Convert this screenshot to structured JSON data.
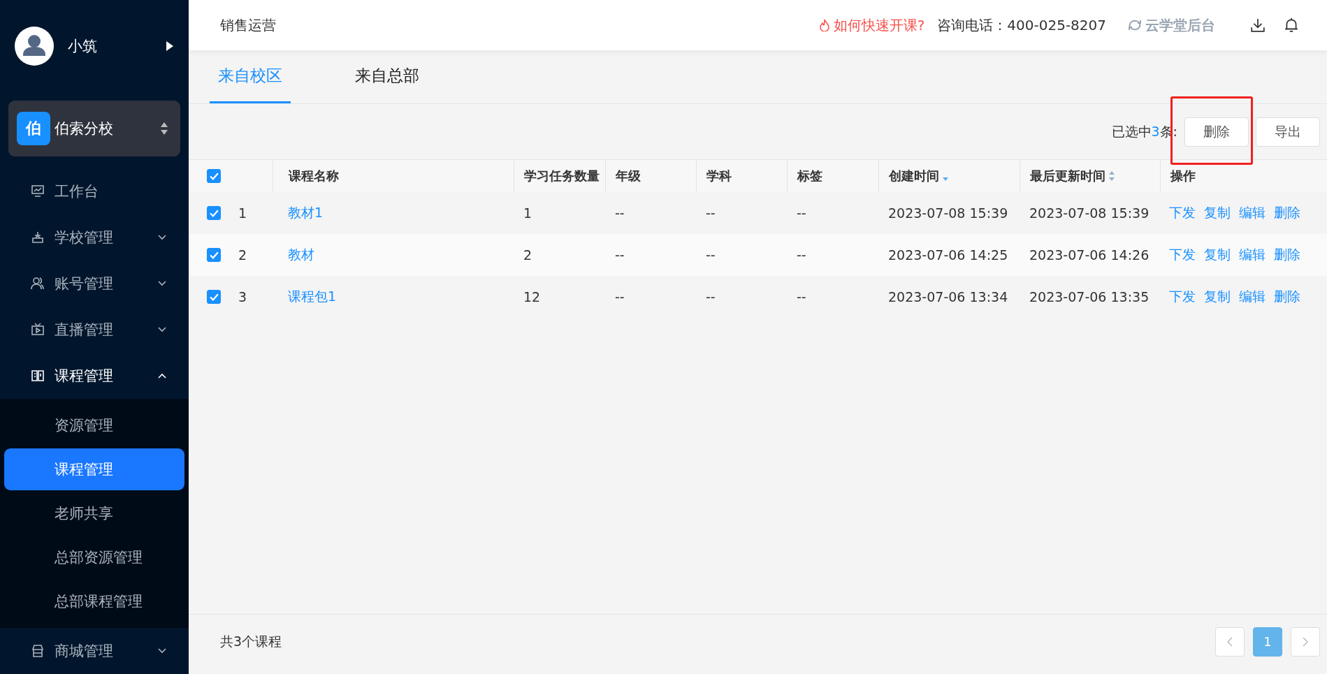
{
  "user": {
    "name": "小筑"
  },
  "campus": {
    "badge": "伯",
    "name": "伯索分校"
  },
  "sidebar": {
    "items": [
      {
        "label": "工作台"
      },
      {
        "label": "学校管理",
        "expanded": false
      },
      {
        "label": "账号管理",
        "expanded": false
      },
      {
        "label": "直播管理",
        "expanded": false
      },
      {
        "label": "课程管理",
        "expanded": true,
        "children": [
          {
            "label": "资源管理",
            "selected": false
          },
          {
            "label": "课程管理",
            "selected": true
          },
          {
            "label": "老师共享",
            "selected": false
          },
          {
            "label": "总部资源管理",
            "selected": false
          },
          {
            "label": "总部课程管理",
            "selected": false
          }
        ]
      },
      {
        "label": "商城管理",
        "expanded": false
      }
    ]
  },
  "header": {
    "title": "销售运营",
    "help_link": "如何快速开课?",
    "hotline": "咨询电话：400-025-8207",
    "backend_link": "云学堂后台"
  },
  "tabs": [
    {
      "label": "来自校区",
      "selected": true
    },
    {
      "label": "来自总部",
      "selected": false
    }
  ],
  "toolbar": {
    "selection_prefix": "已选中",
    "selection_count": "3",
    "selection_suffix": "条:",
    "buttons": [
      {
        "label": "删除",
        "highlighted": true
      },
      {
        "label": "导出"
      }
    ]
  },
  "table": {
    "select_all": {
      "checked": true
    },
    "columns": [
      {
        "label": "课程名称"
      },
      {
        "label": "学习任务数量"
      },
      {
        "label": "年级"
      },
      {
        "label": "学科"
      },
      {
        "label": "标签"
      },
      {
        "label": "创建时间",
        "sorted_desc": true
      },
      {
        "label": "最后更新时间",
        "sorted_desc": false
      },
      {
        "label": "操作"
      }
    ],
    "rows": [
      {
        "checked": true,
        "index": "1",
        "name": "教材1",
        "tasks": "1",
        "grade": "--",
        "subject": "--",
        "tag": "--",
        "created": "2023-07-08 15:39",
        "updated": "2023-07-08 15:39",
        "actions": [
          "下发",
          "复制",
          "编辑",
          "删除"
        ]
      },
      {
        "checked": true,
        "index": "2",
        "name": "教材",
        "tasks": "2",
        "grade": "--",
        "subject": "--",
        "tag": "--",
        "created": "2023-07-06 14:25",
        "updated": "2023-07-06 14:26",
        "actions": [
          "下发",
          "复制",
          "编辑",
          "删除"
        ]
      },
      {
        "checked": true,
        "index": "3",
        "name": "课程包1",
        "tasks": "12",
        "grade": "--",
        "subject": "--",
        "tag": "--",
        "created": "2023-07-06 13:34",
        "updated": "2023-07-06 13:35",
        "actions": [
          "下发",
          "复制",
          "编辑",
          "删除"
        ]
      }
    ]
  },
  "footer": {
    "total": "共3个课程",
    "pages": [
      {
        "label": "1",
        "selected": true
      }
    ]
  }
}
